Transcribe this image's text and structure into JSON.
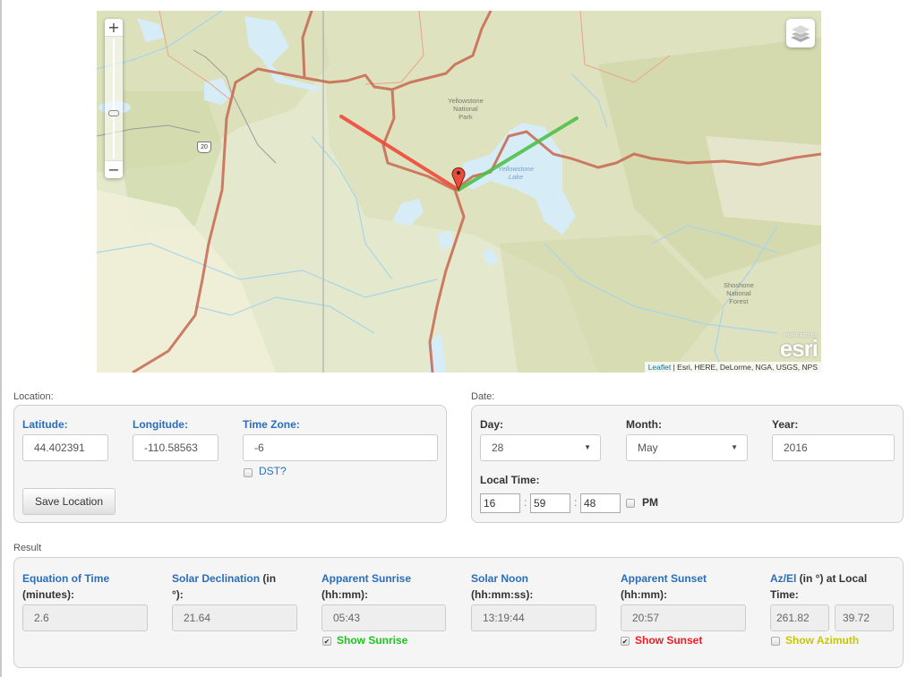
{
  "map": {
    "zoom_in_label": "+",
    "zoom_out_label": "−",
    "layers_icon": "layers-icon",
    "marker_icon": "map-marker-icon",
    "labels": {
      "park": [
        "Yellowstone",
        "National",
        "Park"
      ],
      "lake": [
        "Yellowstone",
        "Lake"
      ],
      "forest": [
        "Shoshone",
        "National",
        "Forest"
      ],
      "route_shield": "20"
    },
    "esri": {
      "powered_by": "POWERED BY",
      "logo": "esri"
    },
    "attribution": {
      "link": "Leaflet",
      "separator": " | ",
      "sources": "Esri, HERE, DeLorme, NGA, USGS, NPS"
    },
    "colors": {
      "sunrise_line": "#4fc14a",
      "sunset_line": "#f04a3a",
      "marker": "#e94b3c",
      "road": "#c96e55",
      "water": "#d6ecf7"
    }
  },
  "location": {
    "section_label": "Location:",
    "latitude_label": "Latitude:",
    "latitude_value": "44.402391",
    "longitude_label": "Longitude:",
    "longitude_value": "-110.58563",
    "timezone_label": "Time Zone:",
    "timezone_value": "-6",
    "dst_label": "DST?",
    "dst_checked": false,
    "save_button": "Save Location"
  },
  "date": {
    "section_label": "Date:",
    "day_label": "Day:",
    "day_value": "28",
    "month_label": "Month:",
    "month_value": "May",
    "year_label": "Year:",
    "year_value": "2016",
    "local_time_label": "Local Time:",
    "hour": "16",
    "minute": "59",
    "second": "48",
    "separator": ":",
    "pm_label": "PM",
    "pm_checked": false
  },
  "result": {
    "section_label": "Result",
    "equation_of_time": {
      "label_blue": "Equation of Time",
      "label_rest": "(minutes):",
      "value": "2.6"
    },
    "solar_declination": {
      "label_blue": "Solar Declination",
      "label_rest_1": " (in",
      "label_rest_2": "°):",
      "value": "21.64"
    },
    "sunrise": {
      "label_blue": "Apparent Sunrise",
      "label_rest": "(hh:mm):",
      "value": "05:43",
      "toggle_label": "Show Sunrise",
      "toggle_checked": true,
      "toggle_color": "#1ec41e"
    },
    "solar_noon": {
      "label_blue": "Solar Noon",
      "label_rest": "(hh:mm:ss):",
      "value": "13:19:44"
    },
    "sunset": {
      "label_blue": "Apparent Sunset",
      "label_rest": "(hh:mm):",
      "value": "20:57",
      "toggle_label": "Show Sunset",
      "toggle_checked": true,
      "toggle_color": "#ee1c24"
    },
    "az_el": {
      "label_blue": "Az/El",
      "label_rest_1": " (in °) at Local",
      "label_rest_2": "Time:",
      "azimuth": "261.82",
      "elevation": "39.72",
      "toggle_label": "Show Azimuth",
      "toggle_checked": false,
      "toggle_color": "#c8c800"
    }
  }
}
